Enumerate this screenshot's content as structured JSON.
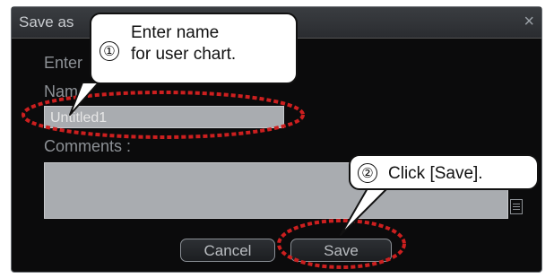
{
  "dialog": {
    "title": "Save as",
    "close_glyph": "×",
    "enter_label": "Enter",
    "name_label": "Name",
    "name_value": "Untitled1",
    "comments_label": "Comments :",
    "comments_value": "",
    "cancel_label": "Cancel",
    "save_label": "Save"
  },
  "callouts": [
    {
      "number": "①",
      "text_line1": "Enter name",
      "text_line2": "for user chart."
    },
    {
      "number": "②",
      "text": "Click [Save]."
    }
  ],
  "colors": {
    "highlight_ring": "#cc1f1f",
    "dialog_bg": "#0b0b0c"
  }
}
